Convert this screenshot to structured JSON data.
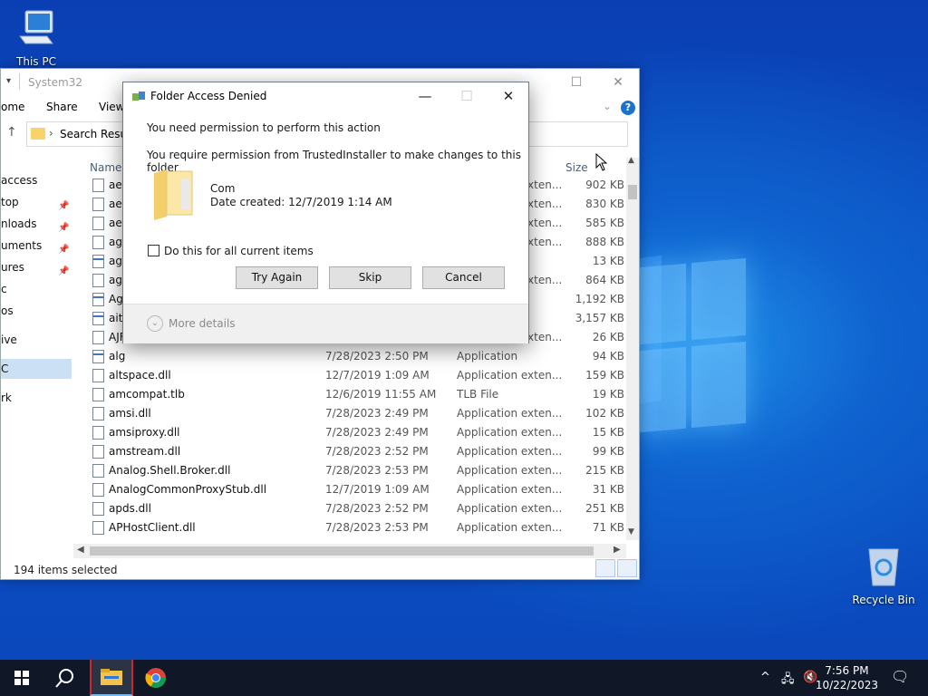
{
  "desktop": {
    "icons": [
      {
        "label": "This PC"
      },
      {
        "label": "Recycle Bin"
      }
    ]
  },
  "explorer": {
    "title": "System32",
    "window_controls": {
      "minimize": "—",
      "maximize": "☐",
      "close": "✕"
    },
    "ribbon": {
      "home": "ome",
      "share": "Share",
      "view": "View"
    },
    "address": {
      "text": "Search Result"
    },
    "nav_items": [
      {
        "label": "access"
      },
      {
        "label": "top"
      },
      {
        "label": "nloads"
      },
      {
        "label": "uments"
      },
      {
        "label": "ures"
      },
      {
        "label": "c"
      },
      {
        "label": "os"
      },
      {
        "label": "ive"
      },
      {
        "label": "C"
      },
      {
        "label": "rk"
      }
    ],
    "columns": {
      "name": "Name",
      "size": "Size"
    },
    "rows": [
      {
        "name": "aei",
        "date": "",
        "type": "Application exten...",
        "size": "902 KB",
        "icon": "dll"
      },
      {
        "name": "aei",
        "date": "",
        "type": "Application exten...",
        "size": "830 KB",
        "icon": "dll"
      },
      {
        "name": "aep",
        "date": "",
        "type": "Application exten...",
        "size": "585 KB",
        "icon": "dll"
      },
      {
        "name": "age",
        "date": "",
        "type": "Application exten...",
        "size": "888 KB",
        "icon": "dll"
      },
      {
        "name": "age",
        "date": "",
        "type": "",
        "size": "13 KB",
        "icon": "app"
      },
      {
        "name": "age",
        "date": "",
        "type": "Application exten...",
        "size": "864 KB",
        "icon": "dll"
      },
      {
        "name": "Ag",
        "date": "",
        "type": "",
        "size": "1,192 KB",
        "icon": "app"
      },
      {
        "name": "aits",
        "date": "",
        "type": "",
        "size": "3,157 KB",
        "icon": "app"
      },
      {
        "name": "AJF",
        "date": "",
        "type": "Application exten...",
        "size": "26 KB",
        "icon": "dll"
      },
      {
        "name": "alg",
        "date": "7/28/2023 2:50 PM",
        "type": "Application",
        "size": "94 KB",
        "icon": "app"
      },
      {
        "name": "altspace.dll",
        "date": "12/7/2019 1:09 AM",
        "type": "Application exten...",
        "size": "159 KB",
        "icon": "dll"
      },
      {
        "name": "amcompat.tlb",
        "date": "12/6/2019 11:55 AM",
        "type": "TLB File",
        "size": "19 KB",
        "icon": "file"
      },
      {
        "name": "amsi.dll",
        "date": "7/28/2023 2:49 PM",
        "type": "Application exten...",
        "size": "102 KB",
        "icon": "dll"
      },
      {
        "name": "amsiproxy.dll",
        "date": "7/28/2023 2:49 PM",
        "type": "Application exten...",
        "size": "15 KB",
        "icon": "dll"
      },
      {
        "name": "amstream.dll",
        "date": "7/28/2023 2:52 PM",
        "type": "Application exten...",
        "size": "99 KB",
        "icon": "dll"
      },
      {
        "name": "Analog.Shell.Broker.dll",
        "date": "7/28/2023 2:53 PM",
        "type": "Application exten...",
        "size": "215 KB",
        "icon": "dll"
      },
      {
        "name": "AnalogCommonProxyStub.dll",
        "date": "12/7/2019 1:09 AM",
        "type": "Application exten...",
        "size": "31 KB",
        "icon": "dll"
      },
      {
        "name": "apds.dll",
        "date": "7/28/2023 2:52 PM",
        "type": "Application exten...",
        "size": "251 KB",
        "icon": "dll"
      },
      {
        "name": "APHostClient.dll",
        "date": "7/28/2023 2:53 PM",
        "type": "Application exten...",
        "size": "71 KB",
        "icon": "dll"
      }
    ],
    "status": "194 items selected"
  },
  "dialog": {
    "title": "Folder Access Denied",
    "heading": "You need permission to perform this action",
    "message": "You require permission from TrustedInstaller to make changes to this folder",
    "item_name": "Com",
    "item_date": "Date created: 12/7/2019 1:14 AM",
    "checkbox_label": "Do this for all current items",
    "buttons": {
      "try_again": "Try Again",
      "skip": "Skip",
      "cancel": "Cancel"
    },
    "more_details": "More details"
  },
  "taskbar": {
    "time": "7:56 PM",
    "date": "10/22/2023"
  }
}
